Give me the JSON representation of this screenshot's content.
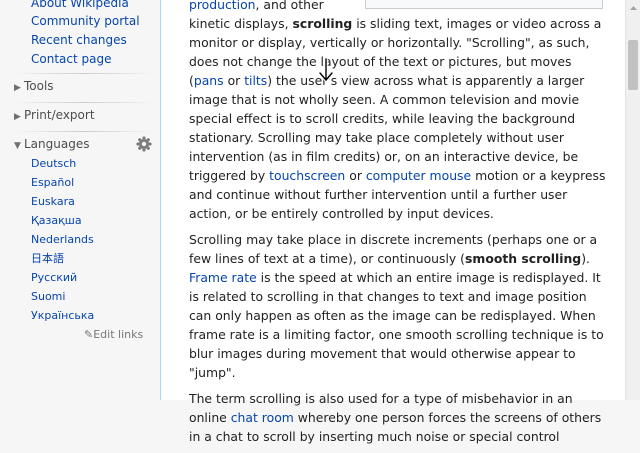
{
  "sidebar": {
    "nav_links": [
      "About Wikipedia",
      "Community portal",
      "Recent changes",
      "Contact page"
    ],
    "tools": "Tools",
    "print_export": "Print/export",
    "languages": "Languages",
    "language_links": [
      "Deutsch",
      "Español",
      "Euskara",
      "Қазақша",
      "Nederlands",
      "日本語",
      "Русский",
      "Suomi",
      "Українська"
    ],
    "edit_links": "Edit links"
  },
  "article": {
    "p1": {
      "t1": "production",
      "t2": ", and other",
      "t3": "kinetic displays, ",
      "t4": "scrolling",
      "t5": " is sliding text, images or video across a monitor or display, vertically or horizontally. \"Scrolling\", as such, does not change the layout of the text or pictures, but moves (",
      "t6": "pans",
      "t7": " or ",
      "t8": "tilts",
      "t9": ") the user's view across what is apparently a larger image that is not wholly seen. A common television and movie special effect is to scroll credits, while leaving the background stationary. Scrolling may take place completely without user intervention (as in film credits) or, on an interactive device, be triggered by ",
      "t10": "touchscreen",
      "t11": " or ",
      "t12": "computer mouse",
      "t13": " motion or a keypress and continue without further intervention until a further user action, or be entirely controlled by input devices."
    },
    "p2": {
      "t1": "Scrolling may take place in discrete increments (perhaps one or a few lines of text at a time), or continuously (",
      "t2": "smooth scrolling",
      "t3": "). ",
      "t4": "Frame rate",
      "t5": " is the speed at which an entire image is redisplayed. It is related to scrolling in that changes to text and image position can only happen as often as the image can be redisplayed. When frame rate is a limiting factor, one smooth scrolling technique is to blur images during movement that would otherwise appear to \"jump\"."
    },
    "p3": {
      "t1": "The term scrolling is also used for a type of misbehavior in an online ",
      "t2": "chat room",
      "t3": " whereby one person forces the screens of others in a chat to scroll by inserting much noise or special control"
    }
  }
}
